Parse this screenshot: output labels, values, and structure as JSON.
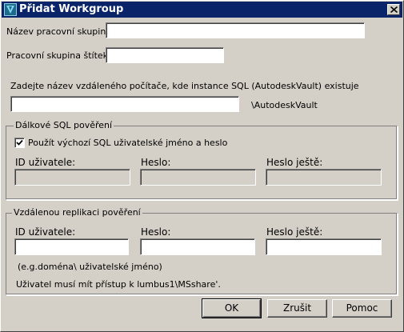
{
  "window": {
    "title": "Přidat Workgroup"
  },
  "fields": {
    "group_name_label": "Název pracovní skupiny:",
    "group_name_value": "",
    "group_tag_label": "Pracovní skupina štítek:",
    "group_tag_value": "",
    "remote_host_prompt": "Zadejte název vzdáleného počítače, kde instance SQL (AutodeskVault) existuje",
    "remote_host_value": "",
    "remote_host_suffix": "\\AutodeskVault"
  },
  "sql_credentials": {
    "title": "Dálkové SQL pověření",
    "use_default_label": "Použít výchozí SQL uživatelské jméno a heslo",
    "use_default_checked": true,
    "user_id_label": "ID uživatele:",
    "password_label": "Heslo:",
    "password_again_label": "Heslo ještě:"
  },
  "replication_credentials": {
    "title": "Vzdálenou replikaci pověření",
    "user_id_label": "ID uživatele:",
    "password_label": "Heslo:",
    "password_again_label": "Heslo ještě:",
    "hint": "(e.g.doména\\ uživatelské jméno)",
    "note": "Uživatel musí mít přístup k lumbus1\\MSshare'."
  },
  "buttons": {
    "ok": "OK",
    "cancel": "Zrušit",
    "help": "Pomoc"
  }
}
